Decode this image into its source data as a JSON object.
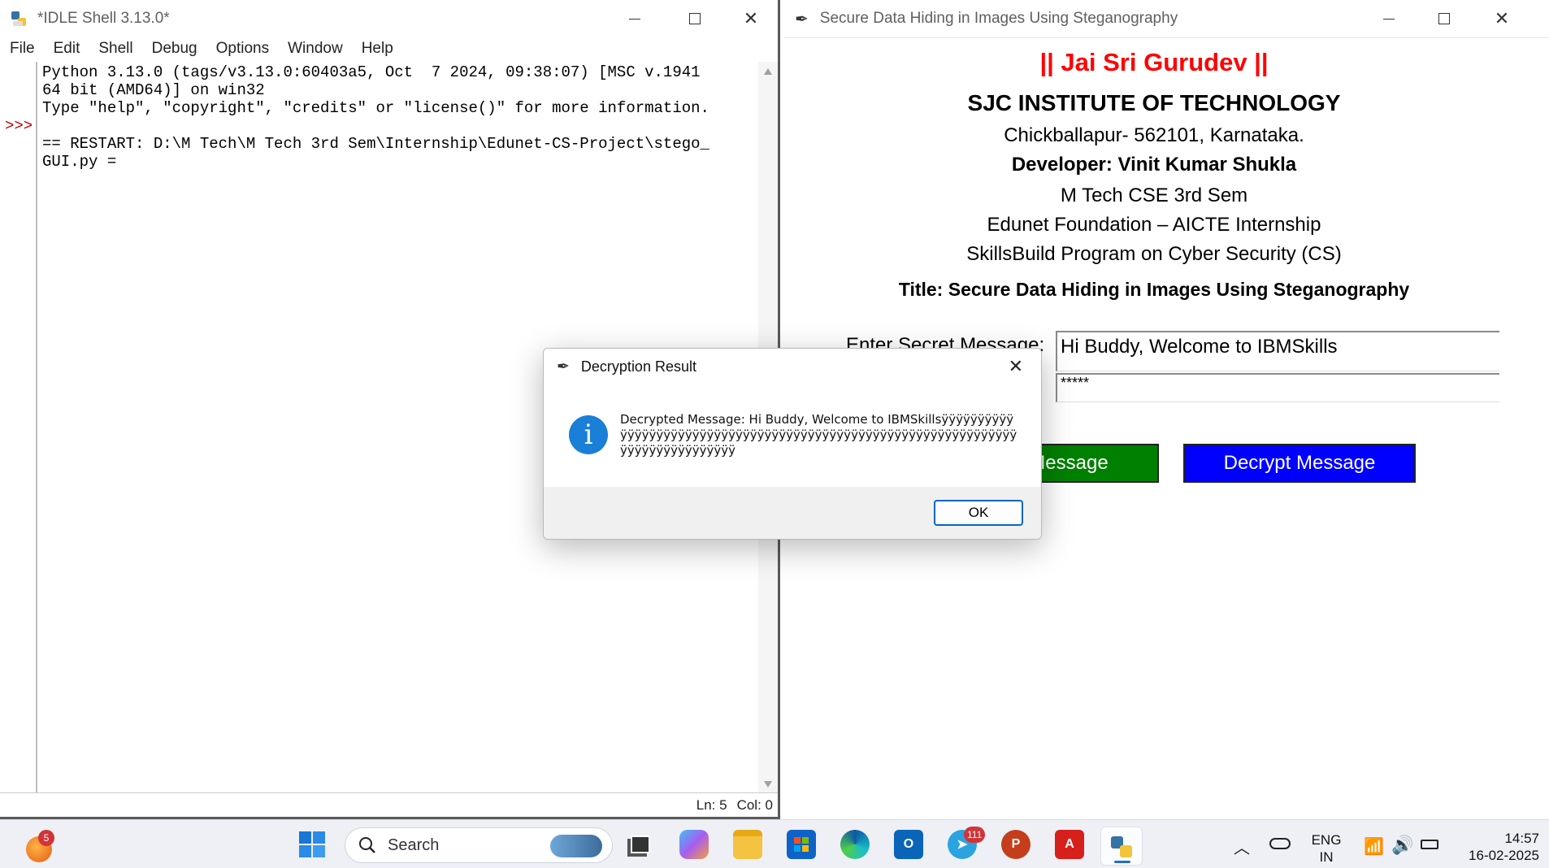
{
  "idle": {
    "title": "*IDLE Shell 3.13.0*",
    "menu": [
      "File",
      "Edit",
      "Shell",
      "Debug",
      "Options",
      "Window",
      "Help"
    ],
    "prompt": ">>>",
    "shell_lines": [
      "Python 3.13.0 (tags/v3.13.0:60403a5, Oct  7 2024, 09:38:07) [MSC v.1941",
      "64 bit (AMD64)] on win32",
      "Type \"help\", \"copyright\", \"credits\" or \"license()\" for more information.",
      "",
      "== RESTART: D:\\M Tech\\M Tech 3rd Sem\\Internship\\Edunet-CS-Project\\stego_",
      "GUI.py ="
    ],
    "status_ln": "Ln: 5",
    "status_col": "Col: 0"
  },
  "stego": {
    "title": "Secure Data Hiding in Images Using Steganography",
    "heading": "|| Jai Sri Gurudev ||",
    "heading_color": "#ff0000",
    "institute": "SJC INSTITUTE OF TECHNOLOGY",
    "address": "Chickballapur- 562101, Karnataka.",
    "developer": "Developer: Vinit Kumar Shukla",
    "course": "M Tech CSE 3rd Sem",
    "foundation": "Edunet Foundation – AICTE Internship",
    "program": "SkillsBuild Program on Cyber Security (CS)",
    "project_title": "Title:  Secure Data Hiding in Images Using Steganography",
    "secret_label": "Enter Secret Message:",
    "secret_value": "Hi Buddy, Welcome to IBMSkills",
    "password_value": "*****",
    "encrypt_label": "Message",
    "encrypt_color": "#008000",
    "decrypt_label": "Decrypt Message",
    "decrypt_color": "#0000ff"
  },
  "dialog": {
    "title": "Decryption Result",
    "message": "Decrypted Message: Hi Buddy, Welcome to IBMSkillsÿÿÿÿÿÿÿÿÿÿÿÿÿÿÿÿÿÿÿÿÿÿÿÿÿÿÿÿÿÿÿÿÿÿÿÿÿÿÿÿÿÿÿÿÿÿÿÿÿÿÿÿÿÿÿÿÿÿÿÿÿÿÿÿÿÿÿÿÿÿÿÿÿÿÿÿÿÿÿÿÿ",
    "ok_label": "OK",
    "icon": "info-icon"
  },
  "taskbar": {
    "notification_count": "5",
    "search_placeholder": "Search",
    "telegram_badge": "111",
    "lang_line1": "ENG",
    "lang_line2": "IN",
    "time": "14:57",
    "date": "16-02-2025",
    "icons": [
      "start-icon",
      "search-icon",
      "task-view-icon",
      "copilot-icon",
      "file-explorer-icon",
      "microsoft-store-icon",
      "edge-icon",
      "outlook-icon",
      "telegram-icon",
      "powerpoint-icon",
      "acrobat-icon",
      "python-idle-icon"
    ]
  }
}
